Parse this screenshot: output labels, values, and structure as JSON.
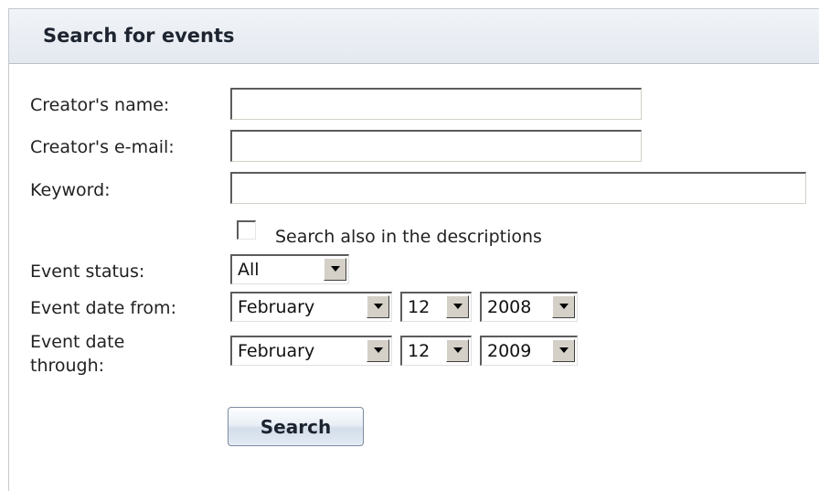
{
  "panel": {
    "title": "Search for events"
  },
  "form": {
    "creator_name": {
      "label": "Creator's name:",
      "value": ""
    },
    "creator_email": {
      "label": "Creator's e-mail:",
      "value": ""
    },
    "keyword": {
      "label": "Keyword:",
      "value": ""
    },
    "search_descriptions": {
      "label": "Search also in the descriptions",
      "checked": false
    },
    "event_status": {
      "label": "Event status:",
      "selected": "All"
    },
    "date_from": {
      "label": "Event date from:",
      "month": "February",
      "day": "12",
      "year": "2008"
    },
    "date_through": {
      "label_line1": "Event date",
      "label_line2": "through:",
      "month": "February",
      "day": "12",
      "year": "2009"
    },
    "search_button_label": "Search"
  },
  "icons": {
    "dropdown_arrow": "chevron-down-icon"
  }
}
